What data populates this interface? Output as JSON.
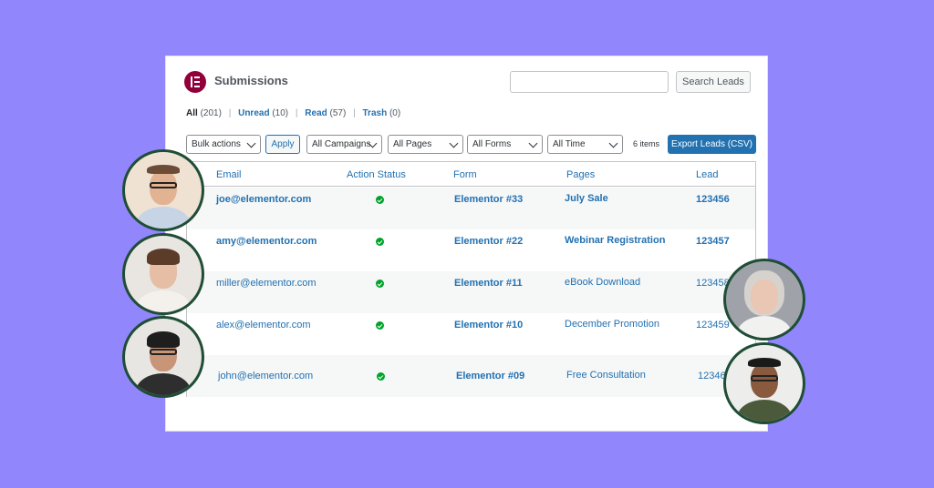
{
  "header": {
    "title": "Submissions",
    "search_placeholder": "",
    "search_button": "Search Leads"
  },
  "filters": {
    "all_label": "All",
    "all_count": "(201)",
    "unread_label": "Unread",
    "unread_count": "(10)",
    "read_label": "Read",
    "read_count": "(57)",
    "trash_label": "Trash",
    "trash_count": "(0)",
    "separator": "|"
  },
  "toolbar": {
    "bulk_actions": "Bulk actions",
    "apply": "Apply",
    "campaigns": "All Campaigns",
    "pages": "All Pages",
    "forms": "All Forms",
    "time": "All Time",
    "items_count": "6 items",
    "export": "Export Leads (CSV)"
  },
  "table": {
    "columns": [
      "Email",
      "Action Status",
      "Form",
      "Pages",
      "Lead"
    ],
    "rows": [
      {
        "email": "joe@elementor.com",
        "form": "Elementor #33",
        "page": "July Sale",
        "lead": "123456"
      },
      {
        "email": "amy@elementor.com",
        "form": "Elementor #22",
        "page": "Webinar Registration",
        "lead": "123457"
      },
      {
        "email": "miller@elementor.com",
        "form": "Elementor #11",
        "page": "eBook Download",
        "lead": "123458"
      },
      {
        "email": "alex@elementor.com",
        "form": "Elementor #10",
        "page": "December Promotion",
        "lead": "123459"
      },
      {
        "email": "john@elementor.com",
        "form": "Elementor #09",
        "page": "Free Consultation",
        "lead": "12346"
      }
    ]
  },
  "colors": {
    "background": "#9286fc",
    "accent": "#2271b1",
    "brand": "#92003b",
    "status_ok": "#00a32a",
    "avatar_ring": "#1f4d36"
  }
}
